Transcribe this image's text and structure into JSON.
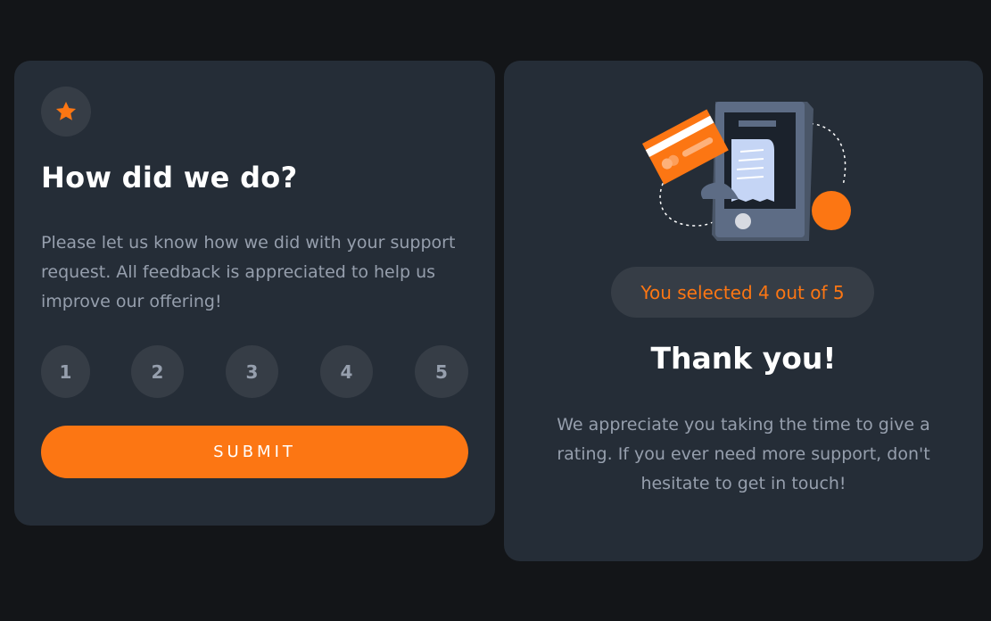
{
  "rating_card": {
    "icon": "star-icon",
    "title": "How did we do?",
    "description": "Please let us know how we did with your support request. All feedback is appreciated to help us improve our offering!",
    "options": [
      "1",
      "2",
      "3",
      "4",
      "5"
    ],
    "submit_label": "SUBMIT"
  },
  "thanks_card": {
    "illustration": "phone-payment-illustration",
    "selected_text": "You selected 4 out of 5",
    "title": "Thank you!",
    "description": "We appreciate you taking the time to give a rating. If you ever need more support, don't hesitate to get in touch!"
  },
  "colors": {
    "page_bg": "#131518",
    "card_bg": "#252D37",
    "chip_bg": "#363D46",
    "accent": "#FC7613",
    "muted_text": "#969FAD",
    "white": "#FFFFFF"
  }
}
